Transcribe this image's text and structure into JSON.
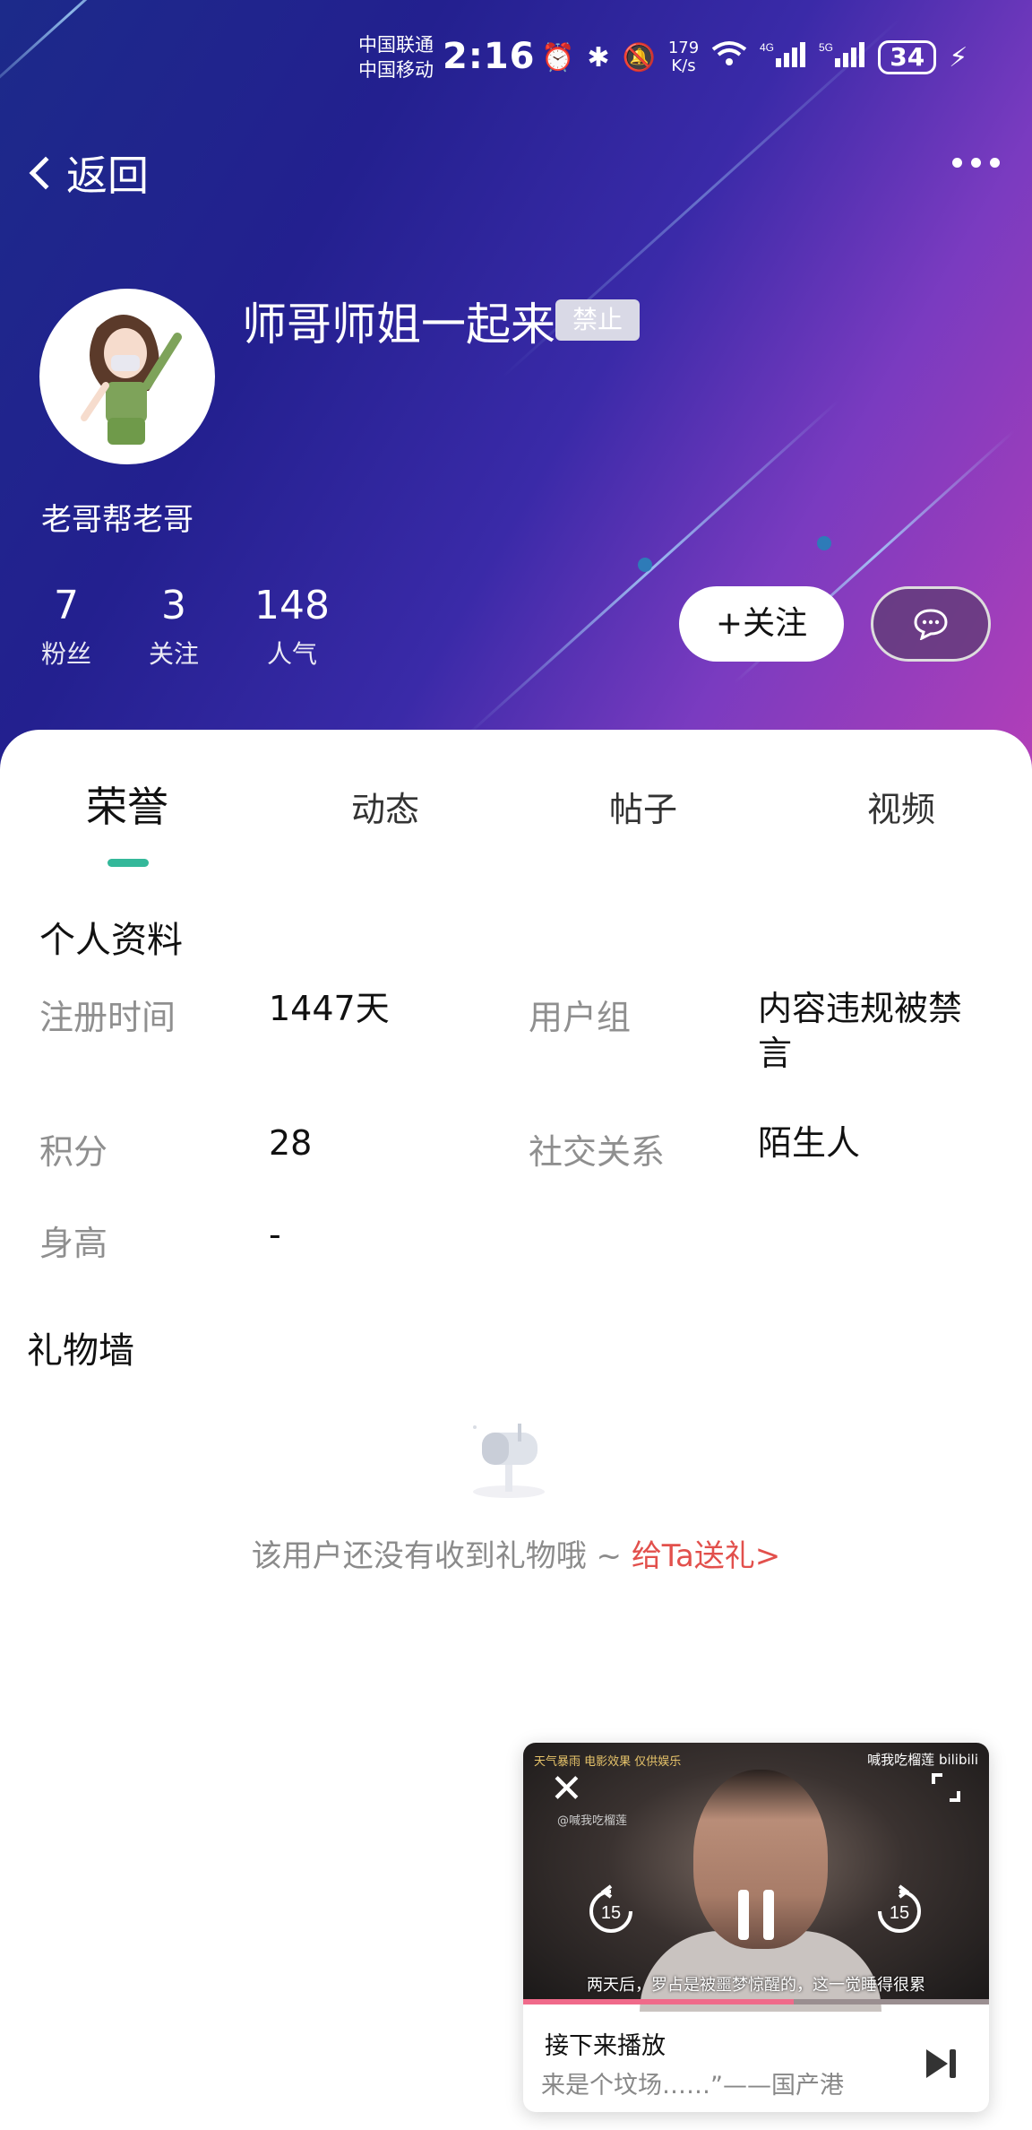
{
  "status_bar": {
    "carrier_1": "中国联通",
    "carrier_2": "中国移动",
    "time": "2:16",
    "speed_value": "179",
    "speed_unit": "K/s",
    "battery": "34"
  },
  "nav": {
    "back_label": "返回"
  },
  "profile": {
    "name": "师哥师姐一起来",
    "ban_badge": "禁止",
    "signature": "老哥帮老哥",
    "stats": [
      {
        "value": "7",
        "label": "粉丝"
      },
      {
        "value": "3",
        "label": "关注"
      },
      {
        "value": "148",
        "label": "人气"
      }
    ],
    "follow_label": "+关注"
  },
  "tabs": [
    {
      "label": "荣誉",
      "active": true
    },
    {
      "label": "动态",
      "active": false
    },
    {
      "label": "帖子",
      "active": false
    },
    {
      "label": "视频",
      "active": false
    }
  ],
  "personal_info": {
    "title": "个人资料",
    "fields": [
      {
        "label": "注册时间",
        "value": "1447天"
      },
      {
        "label": "用户组",
        "value": "内容违规被禁言"
      },
      {
        "label": "积分",
        "value": "28"
      },
      {
        "label": "社交关系",
        "value": "陌生人"
      },
      {
        "label": "身高",
        "value": "-"
      }
    ]
  },
  "gift_wall": {
    "title": "礼物墙",
    "empty_text": "该用户还没有收到礼物哦 ~ ",
    "send_link": "给Ta送礼>"
  },
  "mini_player": {
    "top_caption": "天气暴雨 电影效果 仅供娱乐",
    "brand": "喊我吃榴莲 bilibili",
    "uploader": "@喊我吃榴莲",
    "subtitle": "两天后，罗占是被噩梦惊醒的，这一觉睡得很累",
    "skip_seconds": "15",
    "progress": 0.58,
    "next_label": "接下来播放",
    "next_title": "来是个坟场……”——国产港"
  },
  "colors": {
    "accent_tab": "#34b89a",
    "gift_link": "#e2504c",
    "progress": "#f06a8a"
  }
}
